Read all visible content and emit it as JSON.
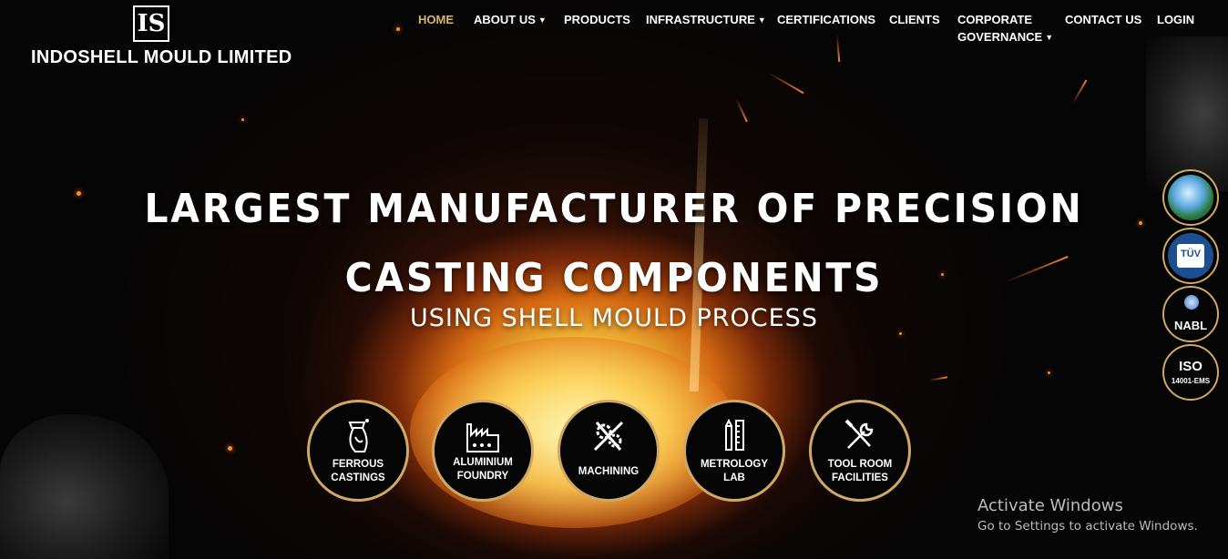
{
  "brand": {
    "logo_text": "INDOSHELL MOULD LIMITED",
    "logo_mark": "IS",
    "accent_color": "#cfa866"
  },
  "nav": {
    "home": "HOME",
    "about": "ABOUT US",
    "products": "PRODUCTS",
    "infrastructure": "INFRASTRUCTURE",
    "certifications": "CERTIFICATIONS",
    "clients": "CLIENTS",
    "corporate_line1": "CORPORATE",
    "corporate_line2": "GOVERNANCE",
    "contact": "CONTACT US",
    "login": "LOGIN",
    "active_color": "#d9b46a"
  },
  "hero": {
    "line1": "LARGEST MANUFACTURER OF PRECISION",
    "line2": "CASTING COMPONENTS",
    "line3": "USING SHELL MOULD PROCESS"
  },
  "services": [
    {
      "line1": "FERROUS",
      "line2": "CASTINGS",
      "icon": "ladle-icon"
    },
    {
      "line1": "ALUMINIUM",
      "line2": "FOUNDRY",
      "icon": "factory-icon"
    },
    {
      "line1": "MACHINING",
      "line2": "",
      "icon": "gears-tools-icon"
    },
    {
      "line1": "METROLOGY",
      "line2": "LAB",
      "icon": "measuring-tools-icon"
    },
    {
      "line1": "TOOL ROOM",
      "line2": "FACILITIES",
      "icon": "wrench-screwdriver-icon"
    }
  ],
  "badges": {
    "tuv": "TÜV",
    "nabl": "NABL",
    "iso": "ISO",
    "iso_sub": "14001-EMS"
  },
  "windows_notice": {
    "title": "Activate Windows",
    "subtitle": "Go to Settings to activate Windows."
  }
}
